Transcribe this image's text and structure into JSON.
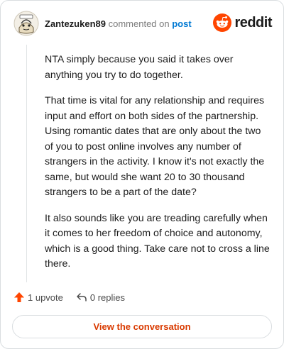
{
  "comment": {
    "username": "Zantezuken89",
    "commented_on": "commented on",
    "post_link": "post",
    "paragraphs": [
      "NTA simply because you said it takes over anything you try to do together.",
      "That time is vital for any relationship and requires input and effort on both sides of the partnership. Using romantic dates that are only about the two of you to post online involves any number of strangers in the activity. I know it's not exactly the same, but would she want 20 to 30 thousand strangers to be a part of the date?",
      "It also sounds like you are treading carefully when it comes to her freedom of choice and autonomy, which is a good thing. Take care not to cross a line there."
    ]
  },
  "brand": {
    "wordmark": "reddit",
    "icon": "reddit-logo-icon"
  },
  "actions": {
    "upvote_label": "1 upvote",
    "upvote_icon": "upvote-arrow-icon",
    "replies_label": "0 replies",
    "replies_icon": "reply-arrow-icon"
  },
  "cta": {
    "label": "View the conversation"
  },
  "colors": {
    "accent": "#ff4500",
    "link": "#0079d3",
    "cta_text": "#d93a00"
  }
}
